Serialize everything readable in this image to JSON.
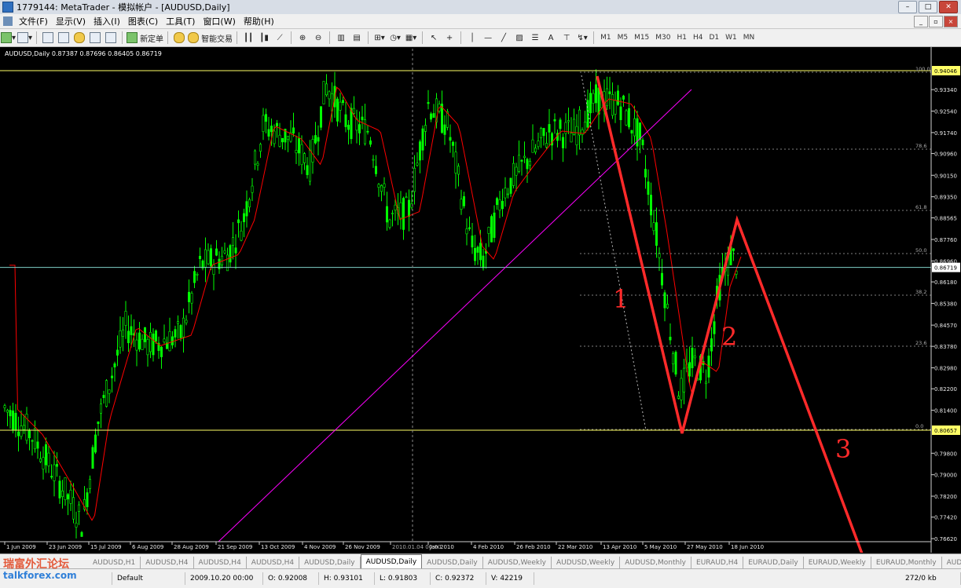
{
  "window": {
    "title": "1779144: MetaTrader - 模拟帐户 - [AUDUSD,Daily]"
  },
  "menu": [
    "文件(F)",
    "显示(V)",
    "插入(I)",
    "图表(C)",
    "工具(T)",
    "窗口(W)",
    "帮助(H)"
  ],
  "toolbar": {
    "new_order": "新定单",
    "expert": "智能交易",
    "timeframes": [
      "M1",
      "M5",
      "M15",
      "M30",
      "H1",
      "H4",
      "D1",
      "W1",
      "MN"
    ]
  },
  "chart_header": "AUDUSD,Daily  0.87387 0.87696 0.86405 0.86719",
  "chart_data": {
    "type": "candlestick",
    "symbol": "AUDUSD,Daily",
    "price_labels": [
      "0.94046",
      "0.93340",
      "0.92540",
      "0.91740",
      "0.90960",
      "0.90150",
      "0.89350",
      "0.88565",
      "0.87760",
      "0.86960",
      "0.86719",
      "0.86180",
      "0.85380",
      "0.84570",
      "0.83780",
      "0.82980",
      "0.82200",
      "0.81400",
      "0.80657",
      "0.79800",
      "0.79000",
      "0.78200",
      "0.77420",
      "0.76620"
    ],
    "highlighted_prices": {
      "top": "0.94046",
      "bottom": "0.80657",
      "current": "0.86719"
    },
    "date_labels": [
      "1 Jun 2009",
      "23 Jun 2009",
      "15 Jul 2009",
      "6 Aug 2009",
      "28 Aug 2009",
      "21 Sep 2009",
      "13 Oct 2009",
      "4 Nov 2009",
      "26 Nov 2009",
      "2010.01.04 00:00",
      "Jan 2010",
      "4 Feb 2010",
      "26 Feb 2010",
      "22 Mar 2010",
      "13 Apr 2010",
      "5 May 2010",
      "27 May 2010",
      "18 Jun 2010"
    ],
    "fibo_levels": [
      "100.0",
      "78.6",
      "61.8",
      "50.0",
      "38.2",
      "23.6",
      "0.0"
    ],
    "wave_labels": [
      "1",
      "2",
      "3"
    ]
  },
  "tabs": [
    "AUDUSD,H1",
    "AUDUSD,H4",
    "AUDUSD,H4",
    "AUDUSD,H4",
    "AUDUSD,Daily",
    "AUDUSD,Daily",
    "AUDUSD,Daily",
    "AUDUSD,Weekly",
    "AUDUSD,Weekly",
    "AUDUSD,Monthly",
    "EURAUD,H4",
    "EURAUD,Daily",
    "EURAUD,Weekly",
    "EURAUD,Monthly",
    "AUD"
  ],
  "active_tab_index": 5,
  "status": {
    "profile": "Default",
    "time": "2009.10.20 00:00",
    "open": "O: 0.92008",
    "high": "H: 0.93101",
    "low": "L: 0.91803",
    "close": "C: 0.92372",
    "volume": "V: 42219",
    "traffic": "272/0 kb"
  },
  "watermark": {
    "line1": "瑞富外汇论坛",
    "line2": "talkforex.com"
  },
  "colors": {
    "candle": "#00ff00",
    "ma": "#ff0000",
    "trend": "#ff00ff",
    "wave": "#ff2a2a",
    "levels": "#ffff66"
  }
}
